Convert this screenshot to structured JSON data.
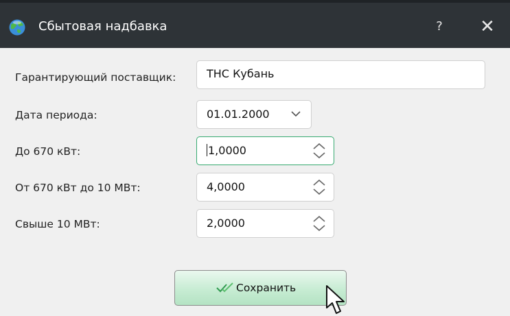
{
  "window": {
    "title": "Сбытовая надбавка",
    "help_label": "?",
    "close_label": "✕",
    "icon": "globe-icon"
  },
  "form": {
    "supplier": {
      "label": "Гарантирующий поставщик:",
      "value": "ТНС Кубань"
    },
    "period": {
      "label": "Дата периода:",
      "value": "01.01.2000",
      "icon": "chevron-down-icon"
    },
    "to670": {
      "label": "До 670 кВт:",
      "value": "1,0000",
      "caret_prefix": "",
      "icon": "spin-updown-icon"
    },
    "from670to10": {
      "label": "От 670 кВт до 10 МВт:",
      "value": "4,0000",
      "icon": "spin-updown-icon"
    },
    "over10": {
      "label": "Свыше 10 МВт:",
      "value": "2,0000",
      "icon": "spin-updown-icon"
    }
  },
  "actions": {
    "save_label": "Сохранить",
    "save_icon": "checkmark-icon"
  },
  "colors": {
    "titlebar": "#2e3337",
    "focus_border": "#35a96f",
    "button_green": "#c7ecd3"
  }
}
